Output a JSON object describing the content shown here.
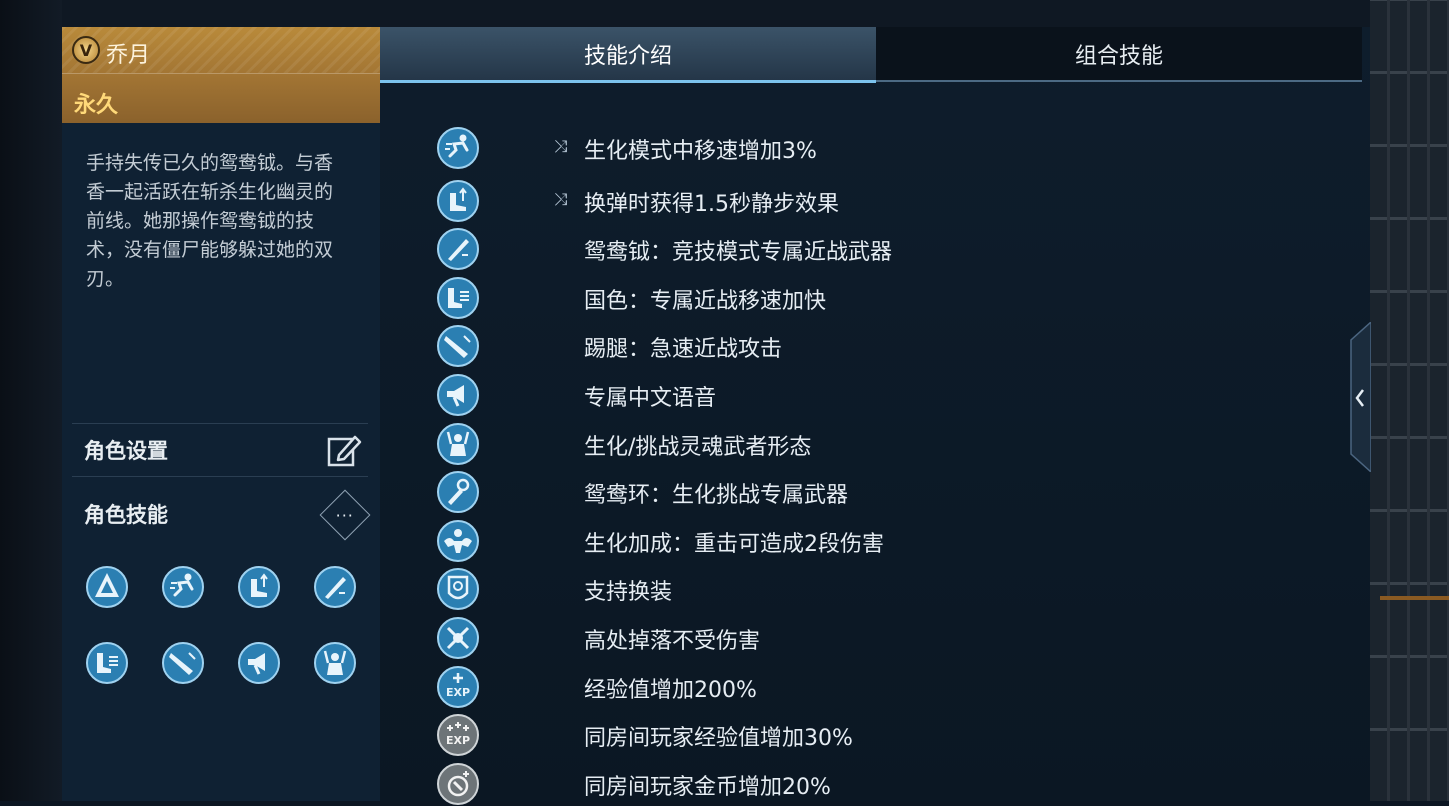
{
  "hero": {
    "name": "乔月",
    "badge_letter": "V",
    "duration": "永久",
    "description": "手持失传已久的鸳鸯钺。与香香一起活跃在斩杀生化幽灵的前线。她那操作鸳鸯钺的技术，没有僵尸能够躲过她的双刃。"
  },
  "sections": {
    "settings_label": "角色设置",
    "skills_label": "角色技能",
    "more_label": "···"
  },
  "tabs": [
    {
      "label": "技能介绍",
      "active": true
    },
    {
      "label": "组合技能",
      "active": false
    }
  ],
  "skill_grid": [
    {
      "icon": "hero-emblem-icon"
    },
    {
      "icon": "running-man-icon"
    },
    {
      "icon": "boot-arrow-icon"
    },
    {
      "icon": "blade-icon"
    },
    {
      "icon": "speed-boot-icon"
    },
    {
      "icon": "kick-icon"
    },
    {
      "icon": "voice-icon"
    },
    {
      "icon": "soul-warrior-icon"
    }
  ],
  "skills": [
    {
      "icon": "running-man-icon",
      "tag": "⤨",
      "text": "生化模式中移速增加3%"
    },
    {
      "icon": "boot-arrow-icon",
      "tag": "⤨",
      "text": "换弹时获得1.5秒静步效果"
    },
    {
      "icon": "blade-icon",
      "tag": "",
      "text": "鸳鸯钺：竞技模式专属近战武器"
    },
    {
      "icon": "speed-boot-icon",
      "tag": "",
      "text": "国色：专属近战移速加快"
    },
    {
      "icon": "kick-icon",
      "tag": "",
      "text": "踢腿：急速近战攻击"
    },
    {
      "icon": "voice-icon",
      "tag": "",
      "text": "专属中文语音"
    },
    {
      "icon": "soul-warrior-icon",
      "tag": "",
      "text": "生化/挑战灵魂武者形态"
    },
    {
      "icon": "ring-blade-icon",
      "tag": "",
      "text": "鸳鸯环：生化挑战专属武器"
    },
    {
      "icon": "muscle-icon",
      "tag": "",
      "text": "生化加成：重击可造成2段伤害"
    },
    {
      "icon": "outfit-icon",
      "tag": "",
      "text": "支持换装"
    },
    {
      "icon": "no-fall-damage-icon",
      "tag": "",
      "text": "高处掉落不受伤害"
    },
    {
      "icon": "exp-plus-icon",
      "tag": "",
      "text": "经验值增加200%"
    },
    {
      "icon": "room-exp-icon",
      "tag": "",
      "text": "同房间玩家经验值增加30%"
    },
    {
      "icon": "room-coin-icon",
      "tag": "",
      "text": "同房间玩家金币增加20%"
    }
  ]
}
